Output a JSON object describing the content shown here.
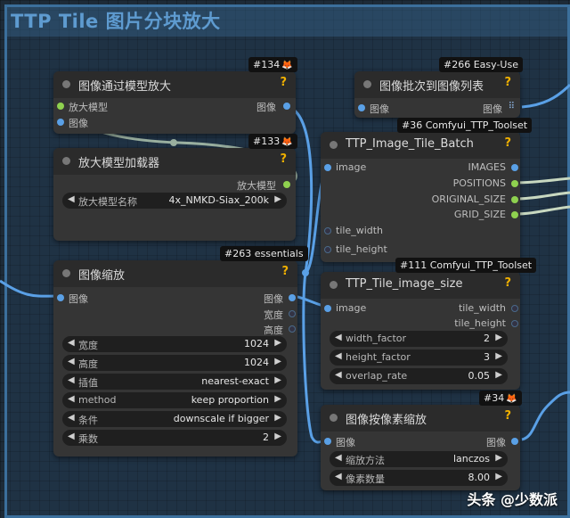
{
  "group": {
    "title": "TTP Tile 图片分块放大"
  },
  "badges": {
    "b134": "#134",
    "b266": "#266 Easy-Use",
    "b36": "#36 Comfyui_TTP_Toolset",
    "b133": "#133",
    "b263": "#263 essentials",
    "b111": "#111 Comfyui_TTP_Toolset",
    "b34": "#34"
  },
  "nodes": {
    "upscale_with_model": {
      "title": "图像通过模型放大",
      "q": "?",
      "in1": "放大模型",
      "in2": "图像",
      "out1": "图像"
    },
    "upscale_model_loader": {
      "title": "放大模型加载器",
      "q": "?",
      "out1": "放大模型",
      "w_label": "放大模型名称",
      "w_value": "4x_NMKD-Siax_200k"
    },
    "image_resize": {
      "title": "图像缩放",
      "q": "?",
      "in1": "图像",
      "out1": "图像",
      "out2": "宽度",
      "out3": "高度",
      "widgets": [
        {
          "label": "宽度",
          "value": "1024"
        },
        {
          "label": "高度",
          "value": "1024"
        },
        {
          "label": "插值",
          "value": "nearest-exact"
        },
        {
          "label": "method",
          "value": "keep proportion"
        },
        {
          "label": "条件",
          "value": "downscale if bigger"
        },
        {
          "label": "乘数",
          "value": "2"
        }
      ]
    },
    "image_batch_to_list": {
      "title": "图像批次到图像列表",
      "q": "?",
      "in1": "图像",
      "out1": "图像"
    },
    "tile_batch": {
      "title": "TTP_Image_Tile_Batch",
      "q": "?",
      "in1": "image",
      "in2": "tile_width",
      "in3": "tile_height",
      "out1": "IMAGES",
      "out2": "POSITIONS",
      "out3": "ORIGINAL_SIZE",
      "out4": "GRID_SIZE"
    },
    "tile_image_size": {
      "title": "TTP_Tile_image_size",
      "q": "?",
      "in1": "image",
      "out1": "tile_width",
      "out2": "tile_height",
      "widgets": [
        {
          "label": "width_factor",
          "value": "2"
        },
        {
          "label": "height_factor",
          "value": "3"
        },
        {
          "label": "overlap_rate",
          "value": "0.05"
        }
      ]
    },
    "image_scale_by": {
      "title": "图像按像素缩放",
      "q": "?",
      "in1": "图像",
      "out1": "图像",
      "widgets": [
        {
          "label": "缩放方法",
          "value": "lanczos"
        },
        {
          "label": "像素数量",
          "value": "8.00"
        }
      ]
    }
  },
  "watermark": "头条 @少数派",
  "colors": {
    "image_slot": "#5aa0e6",
    "model_slot": "#8fd14f",
    "group_border": "#3b6f9c"
  }
}
